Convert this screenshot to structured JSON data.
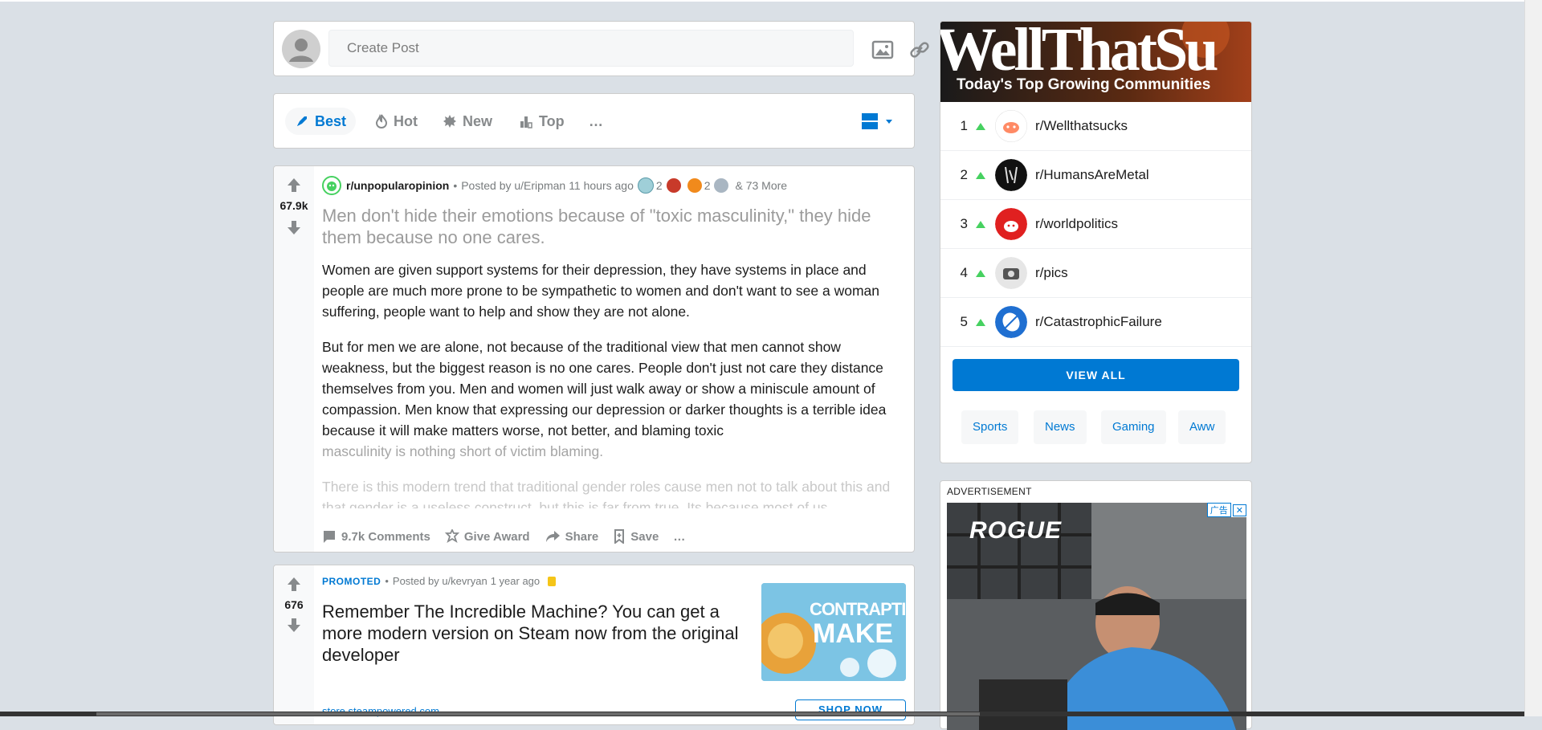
{
  "create_post": {
    "placeholder": "Create Post",
    "image_icon": "image-icon",
    "link_icon": "link-icon"
  },
  "sort": {
    "items": [
      {
        "label": "Best",
        "icon": "rocket-icon",
        "active": true
      },
      {
        "label": "Hot",
        "icon": "flame-icon",
        "active": false
      },
      {
        "label": "New",
        "icon": "burst-icon",
        "active": false
      },
      {
        "label": "Top",
        "icon": "top-chart-icon",
        "active": false
      }
    ],
    "more": "…",
    "layout_icon": "card-layout-icon"
  },
  "posts": [
    {
      "votes": "67.9k",
      "subreddit": "r/unpopularopinion",
      "posted_by": "Posted by u/Eripman",
      "time": "11 hours ago",
      "award_count_1": "2",
      "award_count_2": "2",
      "more_awards": "& 73 More",
      "title": "Men don't hide their emotions because of \"toxic masculinity,\" they hide them because no one cares.",
      "body": [
        "Women are given support systems for their depression, they have systems in place and people are much more prone to be sympathetic to women and don't want to see a woman suffering, people want to help and show they are not alone.",
        "But for men we are alone, not because of the traditional view that men cannot show weakness, but the biggest reason is no one cares. People don't just not care they distance themselves from you. Men and women will just walk away or show a miniscule amount of compassion. Men know that expressing our depression or darker thoughts is a terrible idea because it will make matters worse, not better, and blaming toxic",
        "masculinity is nothing short of victim blaming.",
        "There is this modern trend that traditional gender roles cause men not to talk about this and that gender is a useless construct, but this is far from true. Its because most of us"
      ],
      "actions": {
        "comments": "9.7k Comments",
        "award": "Give Award",
        "share": "Share",
        "save": "Save",
        "more": "…"
      }
    },
    {
      "votes": "676",
      "promoted": "PROMOTED",
      "posted_by": "Posted by u/kevryan",
      "time": "1 year ago",
      "title": "Remember The Incredible Machine? You can get a more modern version on Steam now from the original developer",
      "thumb_text_1": "CONTRAPTIO",
      "thumb_text_2": "MAKE",
      "link": "store.steampowered.com",
      "cta": "SHOP NOW"
    }
  ],
  "trending": {
    "banner_text": "WellThatSu",
    "title": "Today's Top Growing Communities",
    "items": [
      {
        "rank": "1",
        "name": "r/Wellthatsucks"
      },
      {
        "rank": "2",
        "name": "r/HumansAreMetal"
      },
      {
        "rank": "3",
        "name": "r/worldpolitics"
      },
      {
        "rank": "4",
        "name": "r/pics"
      },
      {
        "rank": "5",
        "name": "r/CatastrophicFailure"
      }
    ],
    "view_all": "VIEW ALL",
    "chips": [
      "Sports",
      "News",
      "Gaming",
      "Aww"
    ]
  },
  "ad": {
    "label": "ADVERTISEMENT",
    "brand": "ROGUE",
    "badge": "广告",
    "close": "✕"
  },
  "colors": {
    "accent": "#0079d3",
    "background": "#dae0e6",
    "upvote_green": "#46d160"
  }
}
